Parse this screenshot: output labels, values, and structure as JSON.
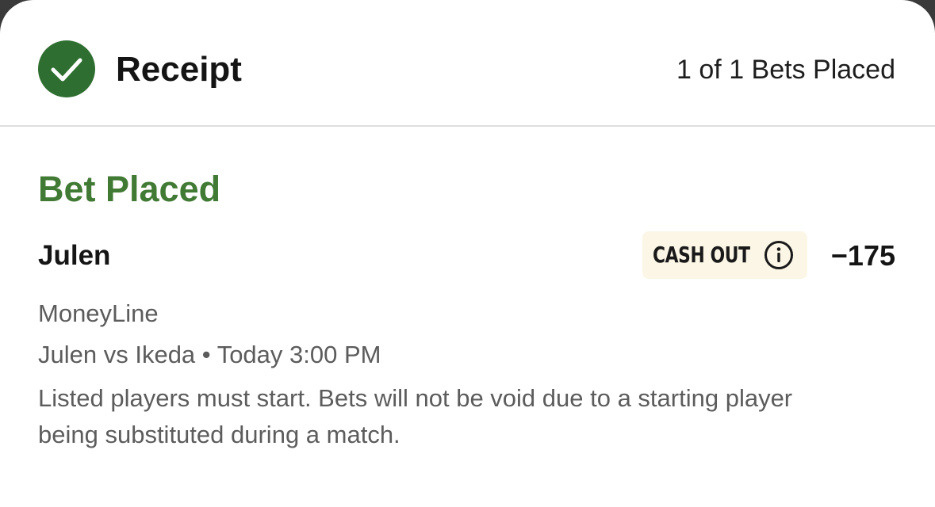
{
  "receipt": {
    "title": "Receipt",
    "bets_count_text": "1 of 1 Bets Placed",
    "check_icon": "check-circle-icon",
    "accent_color": "#2f6e31"
  },
  "bet": {
    "status": "Bet Placed",
    "status_color": "#417a34",
    "selection": "Julen",
    "cash_out_label": "CASH OUT",
    "cash_out_icon": "info-icon",
    "odds": "−175",
    "market": "MoneyLine",
    "event": "Julen vs Ikeda • Today 3:00 PM",
    "rules": "Listed players must start. Bets will not be void due to a starting player being substituted during a match."
  }
}
